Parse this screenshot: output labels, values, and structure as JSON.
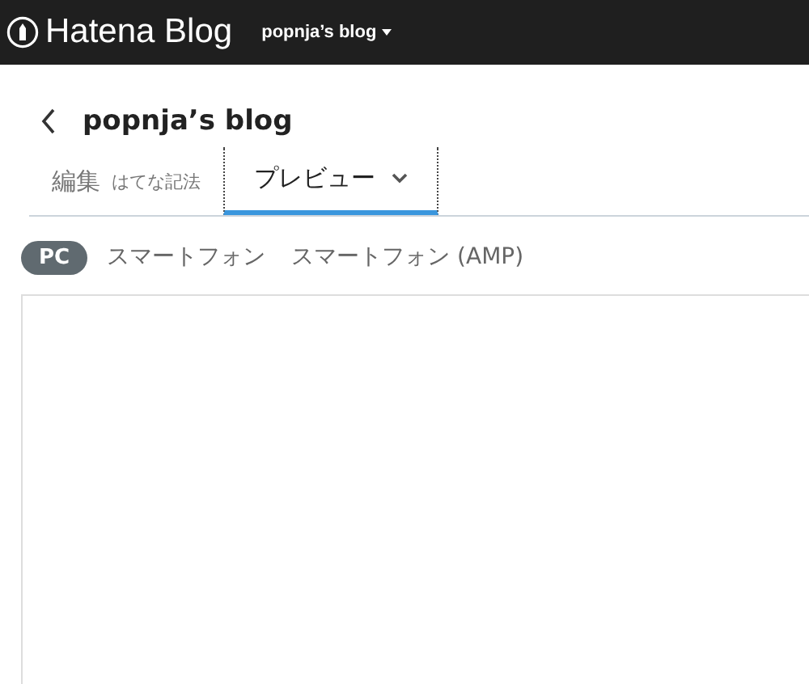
{
  "header": {
    "logo": "Hatena Blog",
    "blog_menu": "popnja’s blog"
  },
  "title": "popnja’s blog",
  "tabs": [
    {
      "label": "編集",
      "note": "はてな記法",
      "selected": false
    },
    {
      "label": "プレビュー",
      "selected": true
    }
  ],
  "devices": [
    {
      "label": "PC",
      "selected": true
    },
    {
      "label": "スマートフォン",
      "selected": false
    },
    {
      "label": "スマートフォン (AMP)",
      "selected": false
    }
  ]
}
